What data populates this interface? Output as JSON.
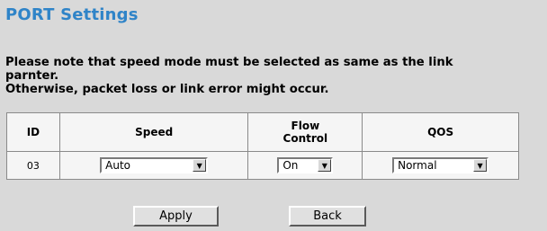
{
  "page": {
    "title": "PORT Settings",
    "note_line1": "Please note that speed mode must be selected as same as the link",
    "note_line2": "parnter.",
    "note_line3": "Otherwise, packet loss or link error might occur."
  },
  "table": {
    "headers": {
      "id": "ID",
      "speed": "Speed",
      "flow_line1": "Flow",
      "flow_line2": "Control",
      "qos": "QOS"
    },
    "rows": [
      {
        "id": "03",
        "speed": "Auto",
        "flow_control": "On",
        "qos": "Normal"
      }
    ]
  },
  "buttons": {
    "apply": "Apply",
    "back": "Back"
  },
  "colors": {
    "title": "#2f84c8",
    "background": "#d9d9d9",
    "table_cell": "#f5f5f5"
  }
}
